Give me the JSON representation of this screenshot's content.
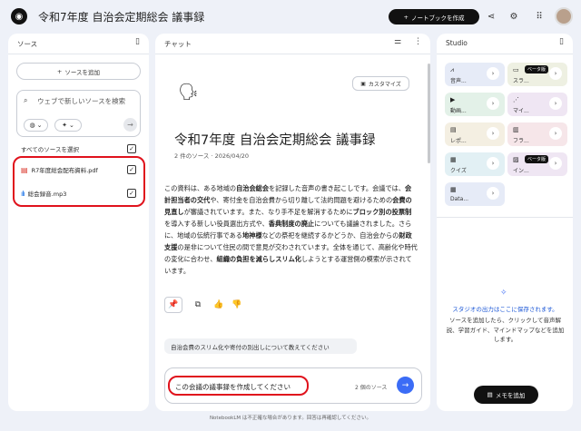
{
  "header": {
    "title": "令和7年度 自治会定期総会 議事録",
    "create_notebook_label": "ノートブックを作成"
  },
  "sources_panel": {
    "heading": "ソース",
    "add_source_label": "ソースを追加",
    "search_placeholder": "ウェブで新しいソースを検索",
    "select_all_label": "すべてのソースを選択",
    "items": [
      {
        "name": "R7年度総会配布資料.pdf",
        "type": "pdf",
        "checked": true
      },
      {
        "name": "総会録音.mp3",
        "type": "audio",
        "checked": true
      }
    ]
  },
  "chat_panel": {
    "heading": "チャット",
    "customize_label": "カスタマイズ",
    "doc_title": "令和7年度 自治会定期総会 議事録",
    "doc_meta": "2 件のソース · 2026/04/20",
    "summary": [
      {
        "t": "この資料は、ある地域の",
        "b": false
      },
      {
        "t": "自治会総会",
        "b": true
      },
      {
        "t": "を記録した音声の書き起こしです。会議では、",
        "b": false
      },
      {
        "t": "会計担当者の交代",
        "b": true
      },
      {
        "t": "や、寄付金を自治会費から切り離して法的問題を避けるための",
        "b": false
      },
      {
        "t": "会費の見直し",
        "b": true
      },
      {
        "t": "が審議されています。また、なり手不足を解消するために",
        "b": false
      },
      {
        "t": "ブロック別の投票制",
        "b": true
      },
      {
        "t": "を導入する新しい役員選出方式や、",
        "b": false
      },
      {
        "t": "香典制度の廃止",
        "b": true
      },
      {
        "t": "についても議論されました。さらに、地域の伝統行事である",
        "b": false
      },
      {
        "t": "地神様",
        "b": true
      },
      {
        "t": "などの祭祀を継続するかどうか、自治会からの",
        "b": false
      },
      {
        "t": "財政支援",
        "b": true
      },
      {
        "t": "の是非について住民の間で意見が交わされています。全体を通じて、高齢化や時代の変化に合わせ、",
        "b": false
      },
      {
        "t": "組織の負担を減らしスリム化",
        "b": true
      },
      {
        "t": "しようとする運営側の模索が示されています。",
        "b": false
      }
    ],
    "suggestion": "自治会費のスリム化や寄付の別出しについて教えてください",
    "input_value": "この会議の議事録を作成してください",
    "source_count": "2 個のソース"
  },
  "studio_panel": {
    "heading": "Studio",
    "tiles": [
      {
        "label": "音声...",
        "icon": "audio-overview-icon",
        "bg": "#e6ebf7",
        "beta": false
      },
      {
        "label": "スラ...",
        "icon": "slides-icon",
        "bg": "#eef0e2",
        "beta": true
      },
      {
        "label": "動画...",
        "icon": "video-icon",
        "bg": "#e3f1e8",
        "beta": false
      },
      {
        "label": "マイ...",
        "icon": "mindmap-icon",
        "bg": "#efe6f3",
        "beta": false
      },
      {
        "label": "レポ...",
        "icon": "report-icon",
        "bg": "#f4efe2",
        "beta": false
      },
      {
        "label": "フラ...",
        "icon": "flashcard-icon",
        "bg": "#f6e6e9",
        "beta": false
      },
      {
        "label": "クイズ",
        "icon": "quiz-icon",
        "bg": "#e2f0f4",
        "beta": false
      },
      {
        "label": "イン...",
        "icon": "infographic-icon",
        "bg": "#efe6f3",
        "beta": true
      },
      {
        "label": "Data...",
        "icon": "datatable-icon",
        "bg": "#e6ebf7",
        "beta": false
      }
    ],
    "beta_label": "ベータ版",
    "info_title": "スタジオの出力はここに保存されます。",
    "info_body": "ソースを追加したら、クリックして音声解説、学習ガイド、マインドマップなどを追加します。",
    "add_note_label": "メモを追加"
  },
  "footer": "NotebookLM は不正確な場合があります。回答は再確認してください。"
}
